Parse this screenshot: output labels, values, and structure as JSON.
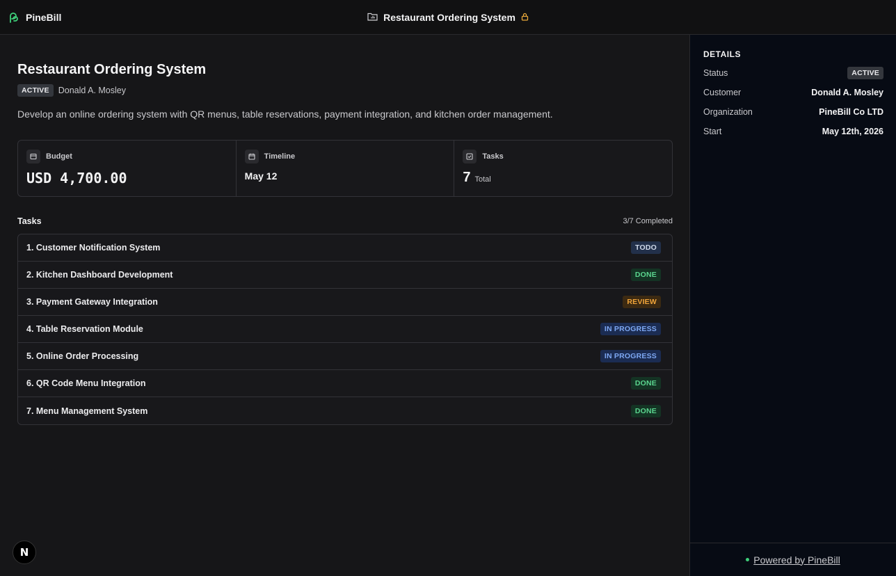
{
  "header": {
    "brand": "PineBill",
    "project_title": "Restaurant Ordering System",
    "icons": {
      "logo": "pinebill-logo-icon",
      "folder": "folder-icon",
      "lock": "lock-icon"
    },
    "colors": {
      "brand_green": "#3ecf7a",
      "lock": "#e8a83a"
    }
  },
  "project": {
    "title": "Restaurant Ordering System",
    "status": "ACTIVE",
    "customer": "Donald A. Mosley",
    "description": "Develop an online ordering system with QR menus, table reservations, payment integration, and kitchen order management."
  },
  "stats": {
    "budget_label": "Budget",
    "budget_value": "USD 4,700.00",
    "timeline_label": "Timeline",
    "timeline_value": "May 12",
    "tasks_label": "Tasks",
    "tasks_count": "7",
    "tasks_total_label": "Total"
  },
  "tasks": {
    "heading": "Tasks",
    "completed": "3/7 Completed",
    "items": [
      {
        "title": "1. Customer Notification System",
        "status": "TODO"
      },
      {
        "title": "2. Kitchen Dashboard Development",
        "status": "DONE"
      },
      {
        "title": "3. Payment Gateway Integration",
        "status": "REVIEW"
      },
      {
        "title": "4. Table Reservation Module",
        "status": "IN PROGRESS"
      },
      {
        "title": "5. Online Order Processing",
        "status": "IN PROGRESS"
      },
      {
        "title": "6. QR Code Menu Integration",
        "status": "DONE"
      },
      {
        "title": "7. Menu Management System",
        "status": "DONE"
      }
    ]
  },
  "details": {
    "heading": "DETAILS",
    "status_label": "Status",
    "status_value": "ACTIVE",
    "customer_label": "Customer",
    "customer_value": "Donald A. Mosley",
    "organization_label": "Organization",
    "organization_value": "PineBill Co LTD",
    "start_label": "Start",
    "start_value": "May 12th, 2026"
  },
  "footer": {
    "powered_by": "Powered by PineBill"
  },
  "dev_badge": {
    "letter": "N"
  }
}
